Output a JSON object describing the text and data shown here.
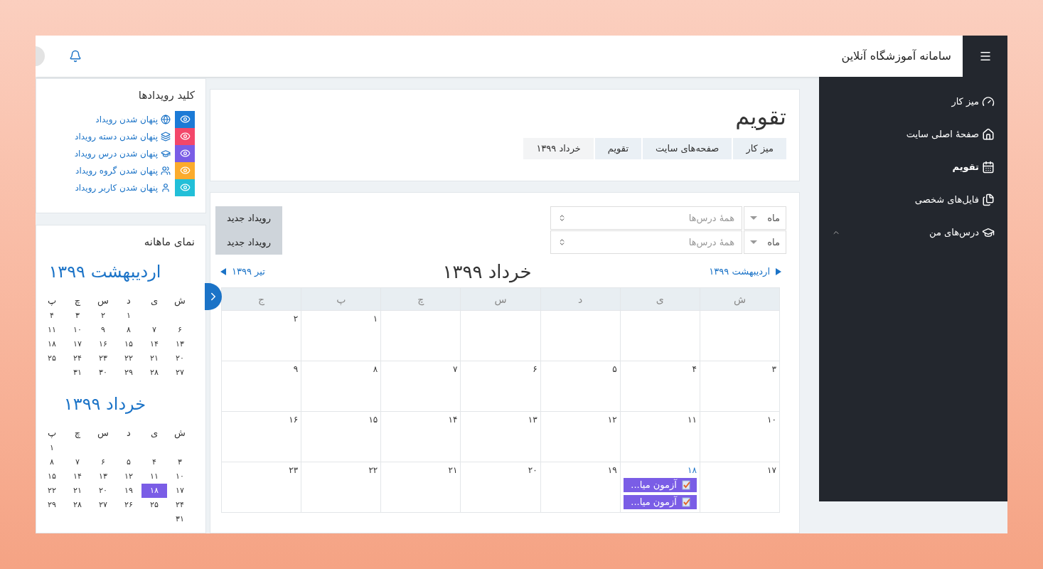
{
  "navbar": {
    "site_title": "سامانه آموزشگاه آنلاین"
  },
  "sidebar": {
    "items": [
      {
        "label": "میز کار",
        "selected": false
      },
      {
        "label": "صفحهٔ اصلی سایت",
        "selected": false
      },
      {
        "label": "تقویم",
        "selected": true
      },
      {
        "label": "فایل‌های شخصی",
        "selected": false
      },
      {
        "label": "درس‌های من",
        "selected": false,
        "expanded": true
      }
    ]
  },
  "page_header": {
    "title": "تقویم",
    "breadcrumb": [
      "میز کار",
      "صفحه‌های سایت",
      "تقویم",
      "خرداد ۱۳۹۹"
    ]
  },
  "event_key": {
    "title": "کلید رویدادها",
    "items": [
      {
        "kind": "site",
        "label": "پنهان شدن رویداد",
        "color": "#1b7ad6"
      },
      {
        "kind": "category",
        "label": "پنهان شدن دسته رویداد",
        "color": "#f3476a"
      },
      {
        "kind": "course",
        "label": "پنهان شدن درس رویداد",
        "color": "#7a5de6"
      },
      {
        "kind": "group",
        "label": "پنهان شدن گروه رویداد",
        "color": "#fbab2c"
      },
      {
        "kind": "user",
        "label": "پنهان شدن کاربر رویداد",
        "color": "#22bfd8"
      }
    ]
  },
  "month_view": {
    "title": "نمای ماهانه",
    "months": [
      {
        "title": "اردیبهشت ۱۳۹۹",
        "weekdays": [
          "ش",
          "ی",
          "د",
          "س",
          "چ",
          "پ"
        ],
        "weeks": [
          [
            {
              "kind": "blank"
            },
            {
              "kind": "blank"
            },
            {
              "kind": "day",
              "day": "۱",
              "selected": false
            },
            {
              "kind": "day",
              "day": "۲",
              "selected": false
            },
            {
              "kind": "day",
              "day": "۳",
              "selected": false
            },
            {
              "kind": "day",
              "day": "۴",
              "selected": false
            }
          ],
          [
            {
              "kind": "day",
              "day": "۶",
              "selected": false
            },
            {
              "kind": "day",
              "day": "۷",
              "selected": false
            },
            {
              "kind": "day",
              "day": "۸",
              "selected": false
            },
            {
              "kind": "day",
              "day": "۹",
              "selected": false
            },
            {
              "kind": "day",
              "day": "۱۰",
              "selected": false
            },
            {
              "kind": "day",
              "day": "۱۱",
              "selected": false
            }
          ],
          [
            {
              "kind": "day",
              "day": "۱۳",
              "selected": false
            },
            {
              "kind": "day",
              "day": "۱۴",
              "selected": false
            },
            {
              "kind": "day",
              "day": "۱۵",
              "selected": false
            },
            {
              "kind": "day",
              "day": "۱۶",
              "selected": false
            },
            {
              "kind": "day",
              "day": "۱۷",
              "selected": false
            },
            {
              "kind": "day",
              "day": "۱۸",
              "selected": false
            }
          ],
          [
            {
              "kind": "day",
              "day": "۲۰",
              "selected": false
            },
            {
              "kind": "day",
              "day": "۲۱",
              "selected": false
            },
            {
              "kind": "day",
              "day": "۲۲",
              "selected": false
            },
            {
              "kind": "day",
              "day": "۲۳",
              "selected": false
            },
            {
              "kind": "day",
              "day": "۲۴",
              "selected": false
            },
            {
              "kind": "day",
              "day": "۲۵",
              "selected": false
            }
          ],
          [
            {
              "kind": "day",
              "day": "۲۷",
              "selected": false
            },
            {
              "kind": "day",
              "day": "۲۸",
              "selected": false
            },
            {
              "kind": "day",
              "day": "۲۹",
              "selected": false
            },
            {
              "kind": "day",
              "day": "۳۰",
              "selected": false
            },
            {
              "kind": "day",
              "day": "۳۱",
              "selected": false
            },
            {
              "kind": "blank"
            }
          ]
        ]
      },
      {
        "title": "خرداد ۱۳۹۹",
        "weekdays": [
          "ش",
          "ی",
          "د",
          "س",
          "چ",
          "پ"
        ],
        "weeks": [
          [
            {
              "kind": "blank"
            },
            {
              "kind": "blank"
            },
            {
              "kind": "blank"
            },
            {
              "kind": "blank"
            },
            {
              "kind": "blank"
            },
            {
              "kind": "day",
              "day": "۱",
              "selected": false
            }
          ],
          [
            {
              "kind": "day",
              "day": "۳",
              "selected": false
            },
            {
              "kind": "day",
              "day": "۴",
              "selected": false
            },
            {
              "kind": "day",
              "day": "۵",
              "selected": false
            },
            {
              "kind": "day",
              "day": "۶",
              "selected": false
            },
            {
              "kind": "day",
              "day": "۷",
              "selected": false
            },
            {
              "kind": "day",
              "day": "۸",
              "selected": false
            }
          ],
          [
            {
              "kind": "day",
              "day": "۱۰",
              "selected": false
            },
            {
              "kind": "day",
              "day": "۱۱",
              "selected": false
            },
            {
              "kind": "day",
              "day": "۱۲",
              "selected": false
            },
            {
              "kind": "day",
              "day": "۱۳",
              "selected": false
            },
            {
              "kind": "day",
              "day": "۱۴",
              "selected": false
            },
            {
              "kind": "day",
              "day": "۱۵",
              "selected": false
            }
          ],
          [
            {
              "kind": "day",
              "day": "۱۷",
              "selected": false
            },
            {
              "kind": "day",
              "day": "۱۸",
              "selected": true
            },
            {
              "kind": "day",
              "day": "۱۹",
              "selected": false
            },
            {
              "kind": "day",
              "day": "۲۰",
              "selected": false
            },
            {
              "kind": "day",
              "day": "۲۱",
              "selected": false
            },
            {
              "kind": "day",
              "day": "۲۲",
              "selected": false
            }
          ],
          [
            {
              "kind": "day",
              "day": "۲۴",
              "selected": false
            },
            {
              "kind": "day",
              "day": "۲۵",
              "selected": false
            },
            {
              "kind": "day",
              "day": "۲۶",
              "selected": false
            },
            {
              "kind": "day",
              "day": "۲۷",
              "selected": false
            },
            {
              "kind": "day",
              "day": "۲۸",
              "selected": false
            },
            {
              "kind": "day",
              "day": "۲۹",
              "selected": false
            }
          ],
          [
            {
              "kind": "day",
              "day": "۳۱",
              "selected": false
            },
            {
              "kind": "blank"
            },
            {
              "kind": "blank"
            },
            {
              "kind": "blank"
            },
            {
              "kind": "blank"
            },
            {
              "kind": "blank"
            }
          ]
        ]
      }
    ]
  },
  "calendar": {
    "filters": [
      {
        "view": "ماه",
        "course": "همهٔ درس‌ها"
      },
      {
        "view": "ماه",
        "course": "همهٔ درس‌ها"
      }
    ],
    "new_event_buttons": [
      "رویداد جدید",
      "رویداد جدید"
    ],
    "prev_month": "اردیبهشت ۱۳۹۹",
    "current_month": "خرداد ۱۳۹۹",
    "next_month": "تیر ۱۳۹۹",
    "weekdays": [
      "ش",
      "ی",
      "د",
      "س",
      "چ",
      "پ",
      "ج"
    ],
    "weeks": [
      [
        {
          "kind": "blank"
        },
        {
          "kind": "blank"
        },
        {
          "kind": "blank"
        },
        {
          "kind": "blank"
        },
        {
          "kind": "blank"
        },
        {
          "kind": "day",
          "day": "۱",
          "today": false
        },
        {
          "kind": "day",
          "day": "۲",
          "today": false
        }
      ],
      [
        {
          "kind": "day",
          "day": "۳",
          "today": false
        },
        {
          "kind": "day",
          "day": "۴",
          "today": false
        },
        {
          "kind": "day",
          "day": "۵",
          "today": false
        },
        {
          "kind": "day",
          "day": "۶",
          "today": false
        },
        {
          "kind": "day",
          "day": "۷",
          "today": false
        },
        {
          "kind": "day",
          "day": "۸",
          "today": false
        },
        {
          "kind": "day",
          "day": "۹",
          "today": false
        }
      ],
      [
        {
          "kind": "day",
          "day": "۱۰",
          "today": false
        },
        {
          "kind": "day",
          "day": "۱۱",
          "today": false
        },
        {
          "kind": "day",
          "day": "۱۲",
          "today": false
        },
        {
          "kind": "day",
          "day": "۱۳",
          "today": false
        },
        {
          "kind": "day",
          "day": "۱۴",
          "today": false
        },
        {
          "kind": "day",
          "day": "۱۵",
          "today": false
        },
        {
          "kind": "day",
          "day": "۱۶",
          "today": false
        }
      ],
      [
        {
          "kind": "day",
          "day": "۱۷",
          "today": false
        },
        {
          "kind": "day",
          "day": "۱۸",
          "today": true,
          "events": [
            "آزمون میا...",
            "آزمون میا..."
          ]
        },
        {
          "kind": "day",
          "day": "۱۹",
          "today": false
        },
        {
          "kind": "day",
          "day": "۲۰",
          "today": false
        },
        {
          "kind": "day",
          "day": "۲۱",
          "today": false
        },
        {
          "kind": "day",
          "day": "۲۲",
          "today": false
        },
        {
          "kind": "day",
          "day": "۲۳",
          "today": false
        }
      ]
    ]
  }
}
